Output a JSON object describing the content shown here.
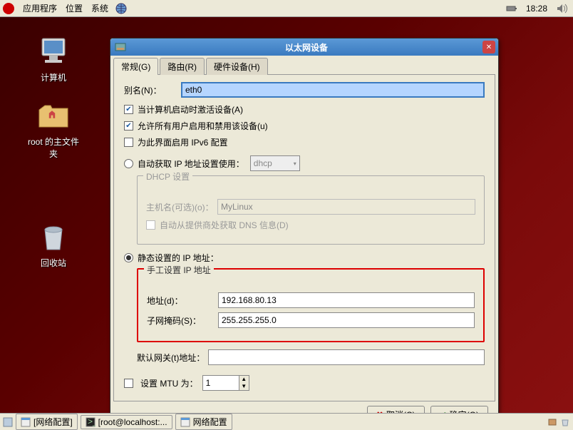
{
  "panel": {
    "menus": [
      "应用程序",
      "位置",
      "系统"
    ],
    "time": "18:28"
  },
  "desktop": {
    "computer": "计算机",
    "home": "root 的主文件夹",
    "trash": "回收站"
  },
  "dialog": {
    "title": "以太网设备",
    "tabs": {
      "general": "常规(G)",
      "route": "路由(R)",
      "hardware": "硬件设备(H)"
    },
    "alias_label": "别名(N)：",
    "alias_value": "eth0",
    "cb_activate": "当计算机启动时激活设备(A)",
    "cb_allusers": "允许所有用户启用和禁用该设备(u)",
    "cb_ipv6": "为此界面启用 IPv6 配置",
    "radio_dhcp": "自动获取 IP 地址设置使用：",
    "dhcp_mode": "dhcp",
    "dhcp_group_title": "DHCP 设置",
    "dhcp_host_label": "主机名(可选)(o)：",
    "dhcp_host_value": "MyLinux",
    "dhcp_autodns": "自动从提供商处获取 DNS 信息(D)",
    "radio_static": "静态设置的 IP 地址：",
    "manual_group_title": "手工设置 IP 地址",
    "addr_label": "地址(d)：",
    "addr_value": "192.168.80.13",
    "mask_label": "子网掩码(S)：",
    "mask_value": "255.255.255.0",
    "gw_label": "默认网关(t)地址：",
    "gw_value": "",
    "mtu_label": "设置 MTU 为：",
    "mtu_value": "1",
    "cancel": "取消(C)",
    "ok": "确定(O)"
  },
  "taskbar": {
    "t1": "[网络配置]",
    "t2": "[root@localhost:...",
    "t3": "网络配置"
  }
}
